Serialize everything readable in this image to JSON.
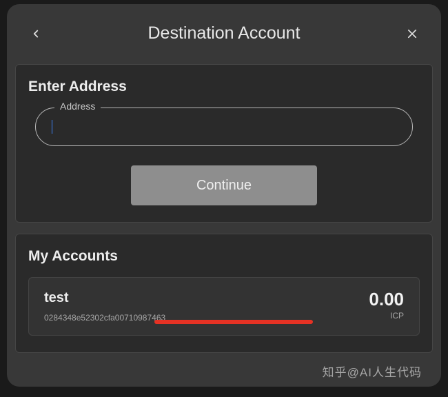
{
  "header": {
    "title": "Destination Account"
  },
  "enter_address": {
    "title": "Enter Address",
    "field_label": "Address",
    "input_value": "",
    "continue_label": "Continue"
  },
  "my_accounts": {
    "title": "My Accounts",
    "items": [
      {
        "name": "test",
        "address": "0284348e52302cfa00710987463",
        "balance": "0.00",
        "currency": "ICP"
      }
    ]
  },
  "watermark": "知乎@AI人生代码"
}
